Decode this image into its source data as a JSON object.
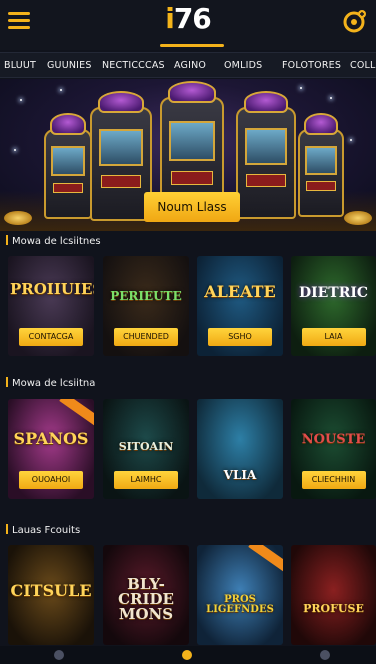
{
  "header": {
    "logo_prefix": "i",
    "logo_number": "76",
    "menu_icon": "hamburger-menu-icon",
    "user_icon": "user-coin-icon"
  },
  "tabs": [
    "BLUUT",
    "GUUNIES",
    "NECTICCCAS",
    "AGINO",
    "OMLIDS",
    "FOLOTORES",
    "COLL"
  ],
  "hero": {
    "button_label": "Noum Llass"
  },
  "sections": [
    {
      "title": "Mowa de lcsiitnes",
      "cards": [
        {
          "title": "PROIIUIES",
          "button": "CONTACGA"
        },
        {
          "title": "PERIEUTE",
          "button": "CHUENDED"
        },
        {
          "title": "ALEATE",
          "button": "SGHO"
        },
        {
          "title": "DIETRIC",
          "button": "LAIA"
        }
      ]
    },
    {
      "title": "Mowa de lcsiitna",
      "cards": [
        {
          "title": "SPANOS",
          "button": "OUOAHOI"
        },
        {
          "title": "SITOAIN",
          "button": "LAIMHC"
        },
        {
          "title": "VLIA",
          "button": ""
        },
        {
          "title": "NOUSTE",
          "button": "CLIECHHIN"
        }
      ]
    },
    {
      "title": "Lauas Fcouits",
      "cards": [
        {
          "title": "CITSULE",
          "button": ""
        },
        {
          "title": "BLY- CRIDE MONS",
          "button": ""
        },
        {
          "title": "PROS LIGEFNDES",
          "button": ""
        },
        {
          "title": "PROFUSE",
          "button": ""
        }
      ]
    }
  ],
  "colors": {
    "accent": "#f3b21b",
    "background": "#10131c"
  }
}
